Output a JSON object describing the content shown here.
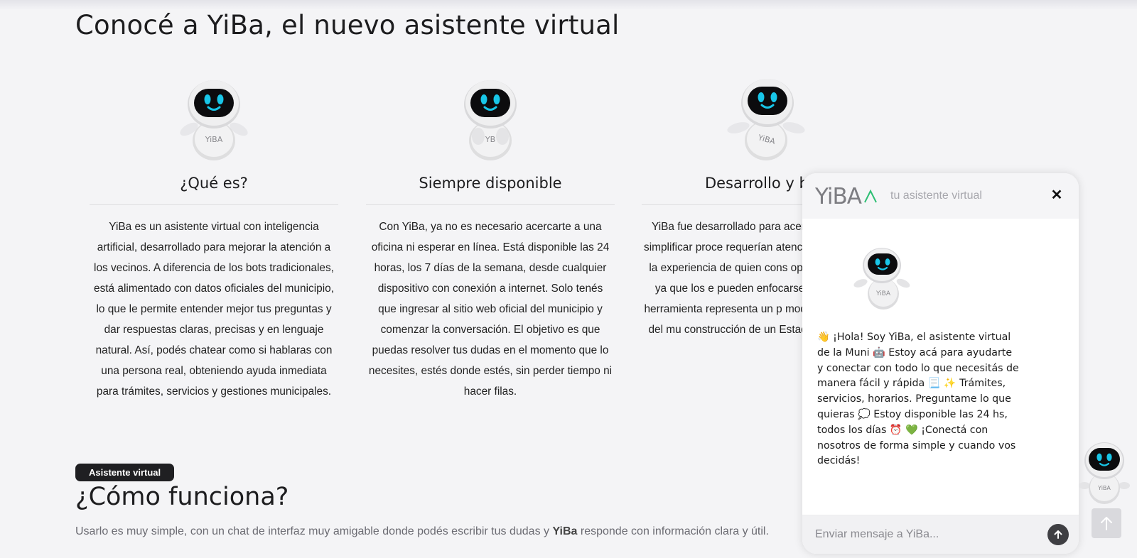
{
  "page": {
    "title": "Conocé a YiBa, el nuevo asistente virtual"
  },
  "features": [
    {
      "title": "¿Qué es?",
      "text": "YiBa es un asistente virtual con inteligencia artificial, desarrollado para mejorar la atención a los vecinos. A diferencia de los bots tradicionales, está alimentado con datos oficiales del municipio, lo que le permite entender mejor tus preguntas y dar respuestas claras, precisas y en lenguaje natural. Así, podés chatear como si hablaras con una persona real, obteniendo ayuda inmediata para trámites, servicios y gestiones municipales."
    },
    {
      "title": "Siempre disponible",
      "text": "Con YiBa, ya no es necesario acercarte a una oficina ni esperar en línea. Está disponible las 24 horas, los 7 días de la semana, desde cualquier dispositivo con conexión a internet. Solo tenés que ingresar al sitio web oficial del municipio y comenzar la conversación. El objetivo es que puedas resolver tus dudas en el momento que lo necesites, estés donde estés, sin perder tiempo ni hacer filas."
    },
    {
      "title": "Desarrollo y ben",
      "text": "YiBa fue desarrollado para acerc cada vecino y simplificar proce requerían atención presencial. Ac la experiencia de quien cons optimizar recursos, ya que los e pueden enfocarse en tareas más herramienta representa un p modernización digital del mu construcción de un Estado más eficiente."
    }
  ],
  "how": {
    "badge": "Asistente virtual",
    "title": "¿Cómo funciona?",
    "desc_before": "Usarlo es muy simple,  con un chat de interfaz muy amigable donde podés escribir tus dudas y ",
    "desc_bold": "YiBa",
    "desc_after": " responde con información clara y útil."
  },
  "chat": {
    "logo_text": "YiBA",
    "subtitle": "tu asistente virtual",
    "close_label": "✕",
    "message": "👋 ¡Hola! Soy YiBa, el asistente virtual de la Muni 🤖 Estoy acá para ayudarte y conectar con todo lo que necesitás de manera fácil y rápida 📃 ✨ Trámites, servicios, horarios. Preguntame lo que quieras 💭 Estoy disponible las 24 hs, todos los días ⏰ 💚 ¡Conectá con nosotros de forma simple y cuando vos decidás!",
    "input_placeholder": "Enviar mensaje a YiBa...",
    "input_value": ""
  },
  "icons": {
    "robot": "robot-mascot-icon",
    "send": "arrow-up-icon",
    "close": "close-icon",
    "to_top": "arrow-up-icon"
  },
  "colors": {
    "background": "#f4f4f6",
    "badge": "#1f1f22",
    "robot_eyes": "#18c6e8",
    "logo_accent": "#2ebf74",
    "send_button": "#3f3f43"
  }
}
